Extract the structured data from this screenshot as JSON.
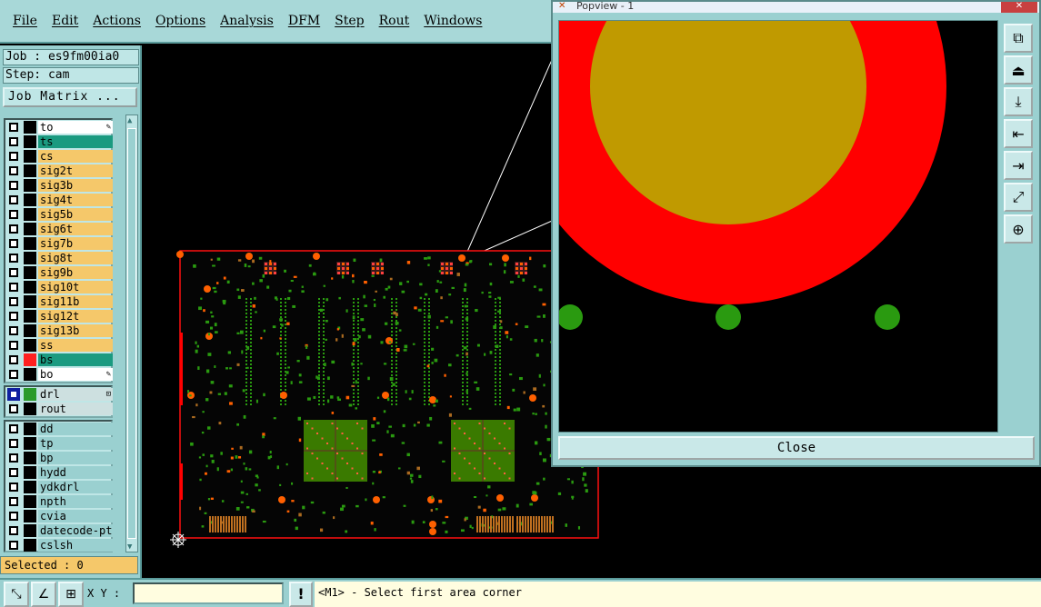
{
  "menu": [
    "File",
    "Edit",
    "Actions",
    "Options",
    "Analysis",
    "DFM",
    "Step",
    "Rout",
    "Windows"
  ],
  "info": {
    "job": "Job : es9fm00ia0",
    "step": "Step: cam",
    "job_matrix_label": "Job Matrix ..."
  },
  "layers_main": [
    {
      "name": "to",
      "style": "white",
      "color": "#000000",
      "mark": "✎"
    },
    {
      "name": "ts",
      "style": "teal",
      "color": "#000000"
    },
    {
      "name": "cs",
      "style": "orange",
      "color": "#000000"
    },
    {
      "name": "sig2t",
      "style": "orange",
      "color": "#000000"
    },
    {
      "name": "sig3b",
      "style": "orange",
      "color": "#000000"
    },
    {
      "name": "sig4t",
      "style": "orange",
      "color": "#000000"
    },
    {
      "name": "sig5b",
      "style": "orange",
      "color": "#000000"
    },
    {
      "name": "sig6t",
      "style": "orange",
      "color": "#000000"
    },
    {
      "name": "sig7b",
      "style": "orange",
      "color": "#000000"
    },
    {
      "name": "sig8t",
      "style": "orange",
      "color": "#000000"
    },
    {
      "name": "sig9b",
      "style": "orange",
      "color": "#000000"
    },
    {
      "name": "sig10t",
      "style": "orange",
      "color": "#000000"
    },
    {
      "name": "sig11b",
      "style": "orange",
      "color": "#000000"
    },
    {
      "name": "sig12t",
      "style": "orange",
      "color": "#000000"
    },
    {
      "name": "sig13b",
      "style": "orange",
      "color": "#000000"
    },
    {
      "name": "ss",
      "style": "orange",
      "color": "#000000"
    },
    {
      "name": "bs",
      "style": "teal",
      "color": "#ff2020"
    },
    {
      "name": "bo",
      "style": "white",
      "color": "#000000",
      "mark": "✎"
    }
  ],
  "layers_drill": [
    {
      "name": "drl",
      "style": "gray",
      "color": "#2a9a2a",
      "mark": "⊡"
    },
    {
      "name": "rout",
      "style": "gray",
      "color": "#000000"
    }
  ],
  "layers_misc": [
    {
      "name": "dd",
      "style": "cyan",
      "color": "#000000"
    },
    {
      "name": "tp",
      "style": "cyan",
      "color": "#000000"
    },
    {
      "name": "bp",
      "style": "cyan",
      "color": "#000000"
    },
    {
      "name": "hydd",
      "style": "cyan",
      "color": "#000000"
    },
    {
      "name": "ydkdrl",
      "style": "cyan",
      "color": "#000000"
    },
    {
      "name": "npth",
      "style": "cyan",
      "color": "#000000"
    },
    {
      "name": "cvia",
      "style": "cyan",
      "color": "#000000"
    },
    {
      "name": "datecode-pte",
      "style": "cyan",
      "color": "#000000"
    },
    {
      "name": "cslsh",
      "style": "cyan",
      "color": "#000000"
    }
  ],
  "selected": "Selected : 0",
  "popview": {
    "title": "Popview - 1",
    "close_label": "Close",
    "tools": [
      "⧉",
      "⏏",
      "⤓",
      "⇤",
      "⇥",
      "⤢",
      "⊕"
    ]
  },
  "status": {
    "xy_label": "X Y :",
    "xy_value": "",
    "message": "<M1> - Select first area corner"
  },
  "colors": {
    "pad_red": "#ff0000",
    "pad_gold": "#c09a00",
    "drill_green": "#2a9a10",
    "copper_orange": "#ff6000"
  }
}
